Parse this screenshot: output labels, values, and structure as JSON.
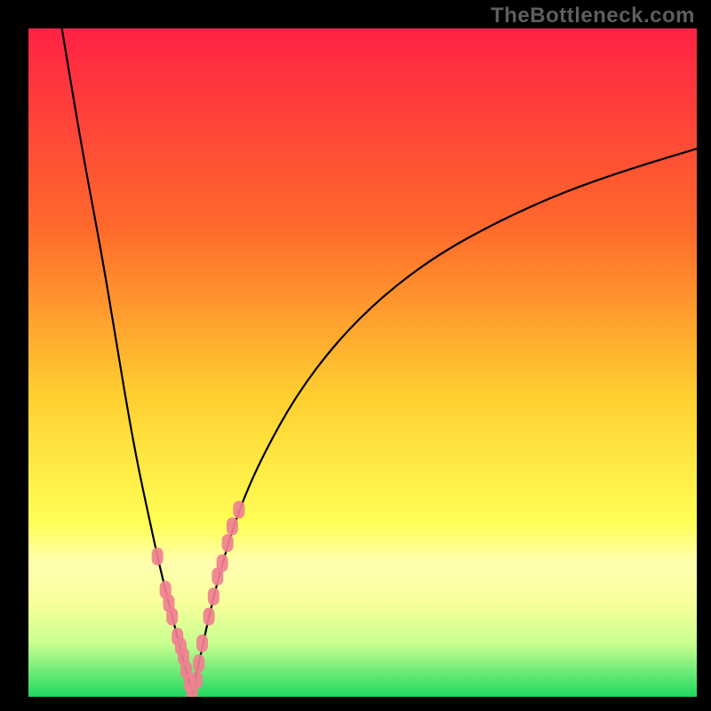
{
  "watermark": "TheBottleneck.com",
  "colors": {
    "frame": "#000000",
    "gradient_top": "#ff2244",
    "gradient_mid1": "#ff8a2a",
    "gradient_mid2": "#ffe040",
    "gradient_band_light": "#ffffaa",
    "gradient_bottom": "#1fd860",
    "curve": "#000000",
    "dot_fill": "#f08090",
    "dot_stroke": "#a84858"
  },
  "chart_data": {
    "type": "line",
    "title": "",
    "xlabel": "",
    "ylabel": "",
    "xlim": [
      0,
      100
    ],
    "ylim": [
      0,
      100
    ],
    "series": [
      {
        "name": "left-branch",
        "x": [
          5,
          8,
          11,
          13,
          15,
          16.5,
          18,
          19.3,
          20.5,
          21.5,
          22.3,
          23,
          23.6,
          24.1,
          24.5
        ],
        "y": [
          100,
          82,
          66,
          54,
          42,
          34,
          27,
          21,
          16,
          12,
          9,
          6,
          4,
          2,
          0.5
        ]
      },
      {
        "name": "right-branch",
        "x": [
          24.5,
          25.5,
          27,
          29,
          31.5,
          35,
          40,
          46,
          53,
          61,
          70,
          80,
          90,
          100
        ],
        "y": [
          0.5,
          5,
          12,
          20,
          28,
          36,
          45,
          53,
          60,
          66,
          71,
          75.5,
          79,
          82
        ]
      }
    ],
    "overlay_points": {
      "name": "highlighted-markers",
      "x": [
        19.3,
        20.5,
        21.0,
        21.5,
        22.3,
        22.8,
        23.2,
        23.6,
        24.1,
        24.5,
        25.2,
        25.5,
        26.0,
        27.0,
        27.7,
        28.3,
        29.0,
        29.8,
        30.5,
        31.5
      ],
      "y": [
        21,
        16,
        14,
        12,
        9,
        7.5,
        6,
        4,
        2,
        0.5,
        2.5,
        5,
        8,
        12,
        15,
        18,
        20,
        23,
        25.5,
        28
      ]
    },
    "gradient_stops": [
      {
        "pos": 0.0,
        "color": "#ff2244"
      },
      {
        "pos": 0.3,
        "color": "#ff6a2c"
      },
      {
        "pos": 0.55,
        "color": "#ffcf30"
      },
      {
        "pos": 0.74,
        "color": "#ffff55"
      },
      {
        "pos": 0.8,
        "color": "#ffffb0"
      },
      {
        "pos": 0.86,
        "color": "#f7ff9a"
      },
      {
        "pos": 0.92,
        "color": "#c9ff90"
      },
      {
        "pos": 1.0,
        "color": "#1fd860"
      }
    ]
  }
}
